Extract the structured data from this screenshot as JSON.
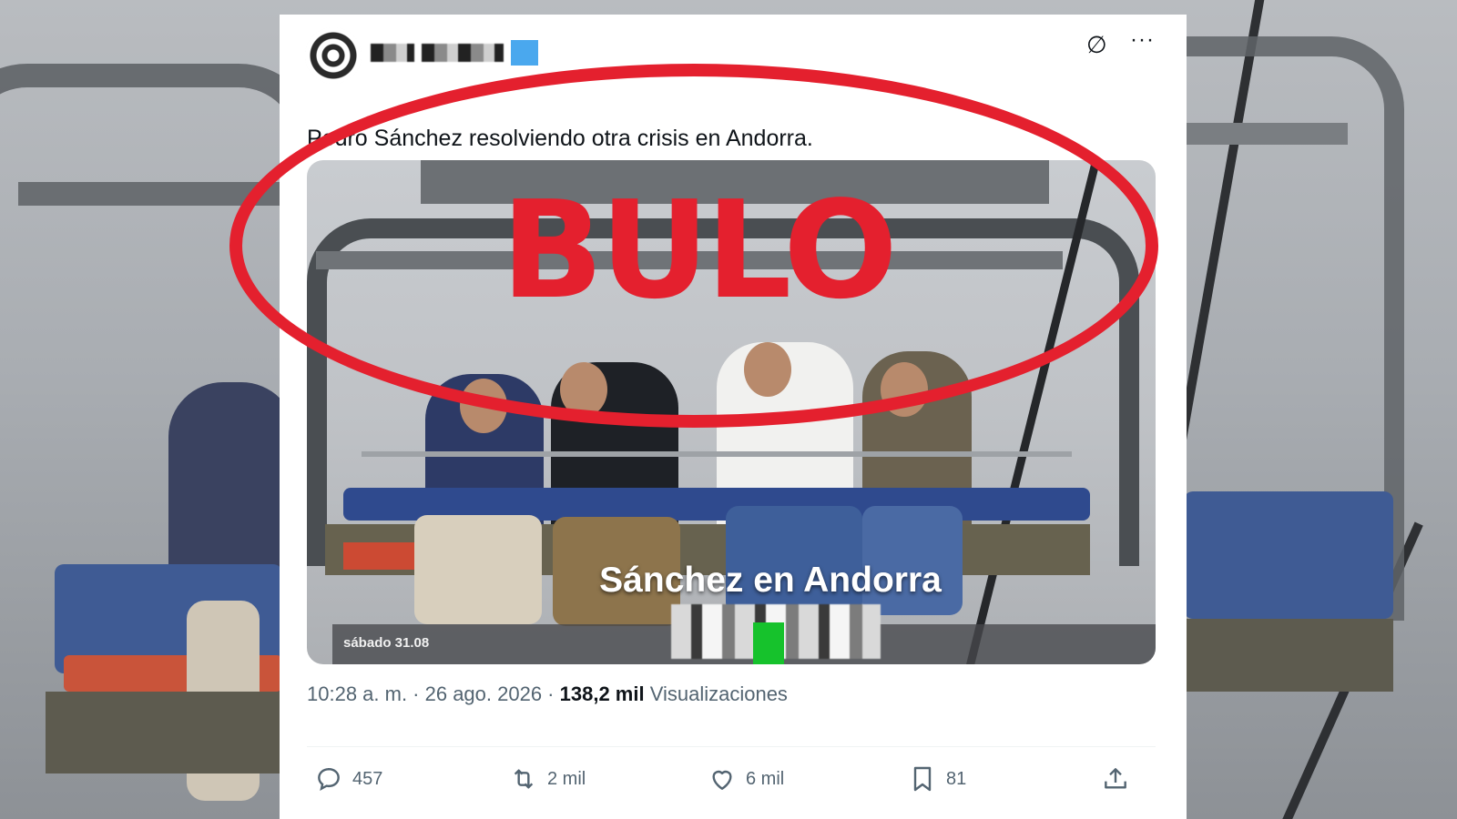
{
  "tweet": {
    "text": "Pedro Sánchez resolviendo otra crisis en Andorra.",
    "timestamp": "10:28 a. m. · 26 ago. 2026 · ",
    "views_count": "138,2 mil",
    "views_label": " Visualizaciones"
  },
  "media": {
    "caption": "Sánchez en Andorra",
    "date_label": "sábado 31.08"
  },
  "actions": {
    "replies": "457",
    "reposts": "2 mil",
    "likes": "6 mil",
    "bookmarks": "81"
  },
  "overlay": {
    "stamp": "BULO",
    "color": "#e4202e"
  },
  "icons": [
    "grok-icon",
    "more-icon",
    "reply-icon",
    "repost-icon",
    "like-icon",
    "bookmark-icon",
    "share-icon"
  ]
}
